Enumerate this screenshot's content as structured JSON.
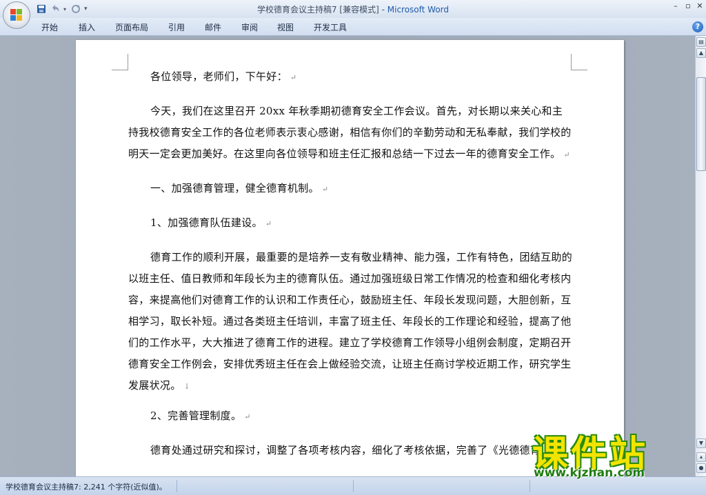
{
  "window": {
    "title": "学校德育会议主持稿7 [兼容模式]",
    "app_name": "Microsoft Word",
    "separator": " - "
  },
  "ribbon_tabs": [
    "开始",
    "插入",
    "页面布局",
    "引用",
    "邮件",
    "审阅",
    "视图",
    "开发工具"
  ],
  "document": {
    "paragraphs": [
      "各位领导，老师们，下午好：",
      "今天，我们在这里召开 20xx 年秋季期初德育安全工作会议。首先，对长期以来关心和主持我校德育安全工作的各位老师表示衷心感谢，相信有你们的辛勤劳动和无私奉献，我们学校的明天一定会更加美好。在这里向各位领导和班主任汇报和总结一下过去一年的德育安全工作。",
      "一、加强德育管理，健全德育机制。",
      "1、加强德育队伍建设。",
      "德育工作的顺利开展，最重要的是培养一支有敬业精神、能力强，工作有特色，团结互助的以班主任、值日教师和年段长为主的德育队伍。通过加强班级日常工作情况的检查和细化考核内容，来提高他们对德育工作的认识和工作责任心，鼓励班主任、年段长发现问题，大胆创新，互相学习，取长补短。通过各类班主任培训，丰富了班主任、年段长的工作理论和经验，提高了他们的工作水平，大大推进了德育工作的进程。建立了学校德育工作领导小组例会制度，定期召开德育安全工作例会，安排优秀班主任在会上做经验交流，让班主任商讨学校近期工作，研究学生发展状况。",
      "2、完善管理制度。",
      "德育处通过研究和探讨，调整了各项考核内容，细化了考核依据，完善了《光德德育"
    ],
    "paragraph_mark": "↵",
    "line_break_mark": "↓"
  },
  "status_bar": {
    "text": "学校德育会议主持稿7: 2,241 个字符(近似值)。"
  },
  "watermark": {
    "title": "课件站",
    "url": "www.kjzhan.com"
  },
  "colors": {
    "app_name": "#1e5aa8",
    "watermark_yellow": "#f2e400",
    "watermark_green": "#2a8a10"
  }
}
